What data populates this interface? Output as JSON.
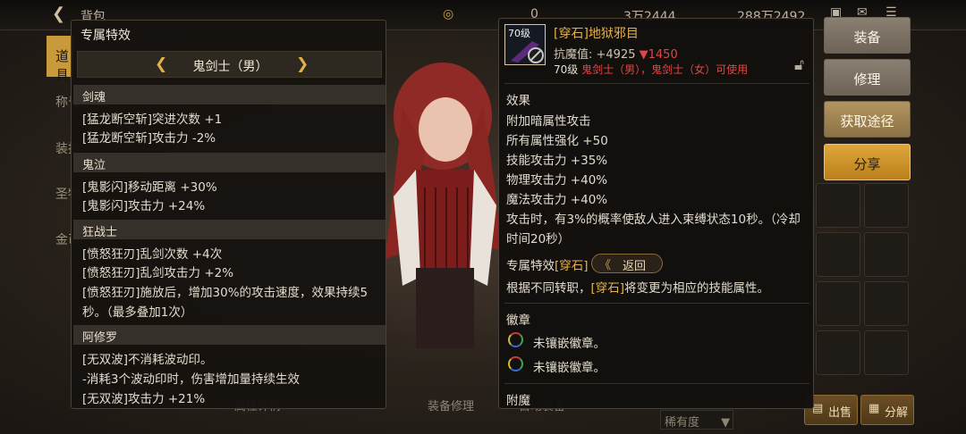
{
  "background": {
    "top_bar": {
      "title": "背包",
      "currency1": "0",
      "currency2": "3万2444",
      "currency3": "288万2492"
    },
    "left_tabs": [
      "道具",
      "称号",
      "装扮",
      "圣物",
      "金币"
    ],
    "bottom": {
      "attr_details": "属性详情",
      "equip_repair": "装备修理",
      "auto_equip": "自动装备",
      "rarity_sort": "稀有度",
      "sell": "出售",
      "decompose": "分解"
    }
  },
  "left_panel": {
    "title": "专属特效",
    "class_selector": "鬼剑士（男）",
    "sections": [
      {
        "header": "剑魂",
        "lines": [
          "[猛龙断空斩]突进次数 +1",
          "[猛龙断空斩]攻击力 -2%"
        ]
      },
      {
        "header": "鬼泣",
        "lines": [
          "[鬼影闪]移动距离 +30%",
          "[鬼影闪]攻击力 +24%"
        ]
      },
      {
        "header": "狂战士",
        "lines": [
          "[愤怒狂刃]乱剑次数 +4次",
          "[愤怒狂刃]乱剑攻击力 +2%",
          "[愤怒狂刃]施放后，增加30%的攻击速度，效果持续5",
          "秒。（最多叠加1次）"
        ]
      },
      {
        "header": "阿修罗",
        "lines": [
          "[无双波]不消耗波动印。",
          "-消耗3个波动印时，伤害增加量持续生效",
          "[无双波]攻击力 +21%"
        ]
      }
    ]
  },
  "item_panel": {
    "level_badge": "70级",
    "name": "[穿石]地狱邪目",
    "anti_demon_label": "抗魔值: +4925",
    "anti_demon_diff": "▼1450",
    "requirement_level": "70级",
    "requirement_classes": "鬼剑士（男），鬼剑士（女）可使用",
    "effect_header": "效果",
    "effects": [
      "附加暗属性攻击",
      "所有属性强化 +50",
      "技能攻击力 +35%",
      "物理攻击力 +40%",
      "魔法攻击力 +40%",
      "攻击时，有3%的概率使敌人进入束缚状态10秒。（冷却",
      "时间20秒）"
    ],
    "exclusive_header": "专属特效",
    "exclusive_tag": "[穿石]",
    "back_button": "返回",
    "exclusive_desc_pre": "根据不同转职，",
    "exclusive_desc_tag": "[穿石]",
    "exclusive_desc_post": "将变更为相应的技能属性。",
    "emblem_header": "徽章",
    "emblem_slots": [
      "未镶嵌徽章。",
      "未镶嵌徽章。"
    ],
    "enchant_header": "附魔"
  },
  "action_buttons": {
    "equip": "装备",
    "repair": "修理",
    "get_route": "获取途径",
    "share": "分享"
  },
  "colors": {
    "accent_gold": "#e6b34c",
    "negative_red": "#e04646",
    "share_button": "#e0a63a"
  }
}
